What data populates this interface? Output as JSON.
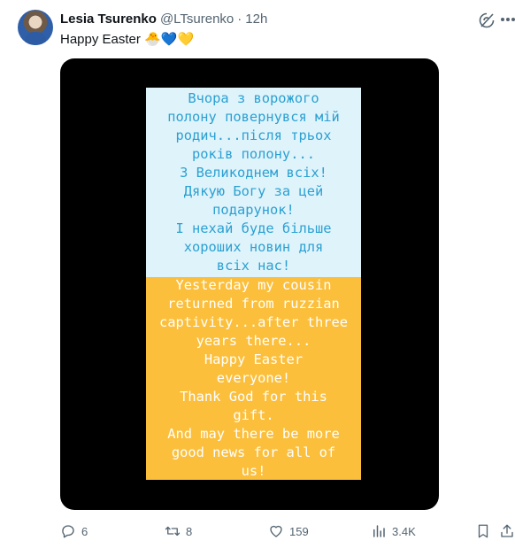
{
  "tweet": {
    "author_name": "Lesia Tsurenko",
    "author_handle": "@LTsurenko",
    "separator": "·",
    "time_ago": "12h",
    "text": "Happy Easter",
    "emojis": [
      "🐣",
      "💙",
      "💛"
    ],
    "icons": [
      "grok-icon",
      "more-icon",
      "reply-icon",
      "retweet-icon",
      "like-icon",
      "views-icon",
      "bookmark-icon",
      "share-icon"
    ]
  },
  "media": {
    "story_ukrainian": "Вчора з ворожого\nполону повернувся мій\nродич...після трьох\nроків полону...\nЗ Великоднем всіх!\nДякую Богу за цей\nподарунок!\nІ нехай буде більше\nхороших новин для\nвсіх нас!",
    "story_english": "Yesterday my cousin\nreturned from ruzzian\ncaptivity...after three\nyears there...\nHappy Easter\neveryone!\nThank God for this\ngift.\nAnd may there be more\ngood news for all of\nus!",
    "colors": {
      "top_background": "#dff3fb",
      "top_text": "#2ba0d2",
      "bottom_background": "#fbbf3c",
      "bottom_text": "#ffffff",
      "frame": "#000000"
    }
  },
  "actions": {
    "replies": "6",
    "reposts": "8",
    "likes": "159",
    "views": "3.4K"
  }
}
